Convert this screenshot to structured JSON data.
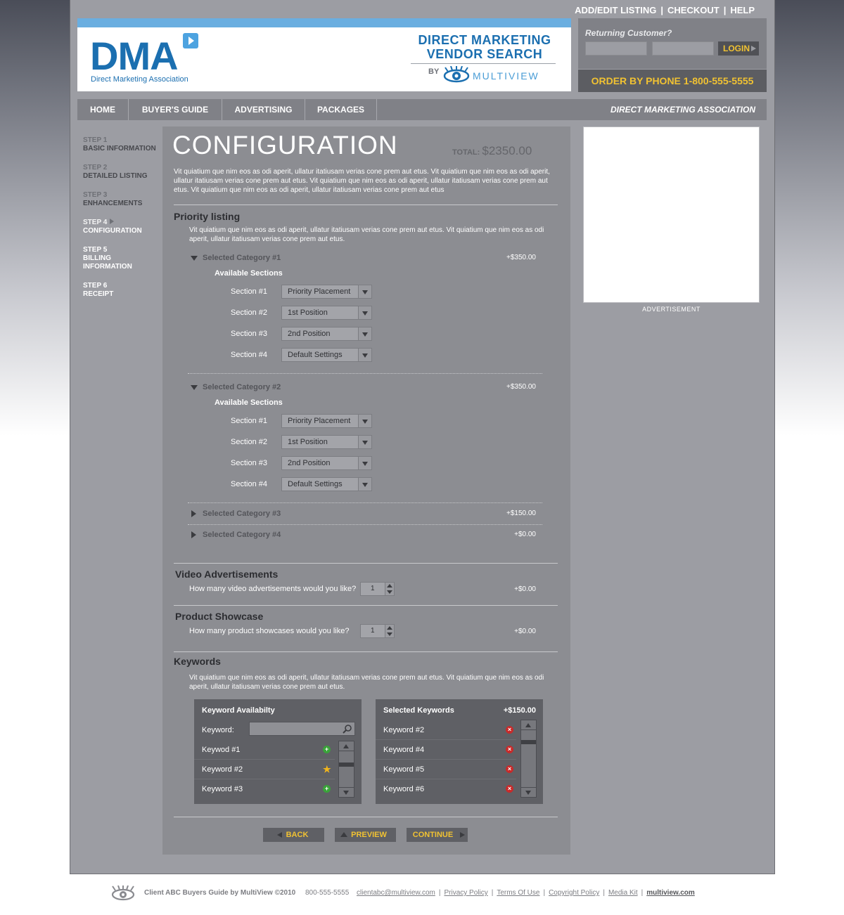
{
  "top_links": [
    "ADD/EDIT LISTING",
    "CHECKOUT",
    "HELP"
  ],
  "header": {
    "logo_text": "DMA",
    "logo_subtitle": "Direct Marketing Association",
    "vendor_title_1": "DIRECT MARKETING",
    "vendor_title_2": "VENDOR SEARCH",
    "by_label": "BY",
    "multiview_text": "MULTIVIEW"
  },
  "login": {
    "title": "Returning Customer?",
    "button_label": "LOGIN",
    "username_value": "",
    "password_value": ""
  },
  "phone_banner": "ORDER BY PHONE 1-800-555-5555",
  "nav": {
    "items": [
      "HOME",
      "BUYER'S GUIDE",
      "ADVERTISING",
      "PACKAGES"
    ],
    "right_label": "DIRECT MARKETING ASSOCIATION"
  },
  "steps": [
    {
      "num": "STEP 1",
      "label": "BASIC INFORMATION"
    },
    {
      "num": "STEP 2",
      "label": "DETAILED LISTING"
    },
    {
      "num": "STEP 3",
      "label": "ENHANCEMENTS"
    },
    {
      "num": "STEP 4",
      "label": "CONFIGURATION"
    },
    {
      "num": "STEP 5",
      "label": "BILLING INFORMATION"
    },
    {
      "num": "STEP 6",
      "label": "RECEIPT"
    }
  ],
  "main": {
    "title": "CONFIGURATION",
    "total_label": "TOTAL:",
    "total_value": "$2350.00",
    "intro": "Vit quiatium que nim eos as odi aperit, ullatur itatiusam verias cone prem aut etus. Vit quiatium que nim eos as odi aperit, ullatur itatiusam verias cone prem aut etus. Vit quiatium que nim eos as odi aperit, ullatur itatiusam verias cone prem aut etus. Vit quiatium que nim eos as odi aperit, ullatur itatiusam verias cone prem aut etus"
  },
  "priority": {
    "title": "Priority listing",
    "desc": "Vit quiatium que nim eos as odi aperit, ullatur itatiusam verias cone prem aut etus. Vit quiatium que nim eos as odi aperit, ullatur itatiusam verias cone prem aut etus.",
    "available_label": "Available Sections",
    "categories": [
      {
        "label": "Selected Category #1",
        "price": "+$350.00",
        "expanded": true,
        "sections": [
          {
            "label": "Section #1",
            "value": "Priority Placement"
          },
          {
            "label": "Section #2",
            "value": "1st Position"
          },
          {
            "label": "Section #3",
            "value": "2nd Position"
          },
          {
            "label": "Section #4",
            "value": "Default Settings"
          }
        ]
      },
      {
        "label": "Selected Category #2",
        "price": "+$350.00",
        "expanded": true,
        "sections": [
          {
            "label": "Section #1",
            "value": "Priority Placement"
          },
          {
            "label": "Section #2",
            "value": "1st Position"
          },
          {
            "label": "Section #3",
            "value": "2nd Position"
          },
          {
            "label": "Section #4",
            "value": "Default Settings"
          }
        ]
      },
      {
        "label": "Selected Category #3",
        "price": "+$150.00",
        "expanded": false
      },
      {
        "label": "Selected Category #4",
        "price": "+$0.00",
        "expanded": false
      }
    ]
  },
  "video": {
    "title": "Video Advertisements",
    "question": "How many video advertisements would you like?",
    "value": "1",
    "price": "+$0.00"
  },
  "showcase": {
    "title": "Product Showcase",
    "question": "How many product showcases would you like?",
    "value": "1",
    "price": "+$0.00"
  },
  "keywords": {
    "title": "Keywords",
    "desc": "Vit quiatium que nim eos as odi aperit, ullatur itatiusam verias cone prem aut etus. Vit quiatium que nim eos as odi aperit, ullatur itatiusam verias cone prem aut etus.",
    "availability": {
      "title": "Keyword Availabilty",
      "search_label": "Keyword:",
      "search_value": "",
      "items": [
        {
          "label": "Keywod #1",
          "icon": "add-icon"
        },
        {
          "label": "Keyword #2",
          "icon": "star-icon"
        },
        {
          "label": "Keyword #3",
          "icon": "add-icon"
        }
      ]
    },
    "selected": {
      "title": "Selected Keywords",
      "price": "+$150.00",
      "items": [
        {
          "label": "Keyword #2",
          "icon": "remove-icon"
        },
        {
          "label": "Keyword #4",
          "icon": "remove-icon"
        },
        {
          "label": "Keyword #5",
          "icon": "remove-icon"
        },
        {
          "label": "Keyword #6",
          "icon": "remove-icon"
        }
      ]
    }
  },
  "actions": {
    "back": "BACK",
    "preview": "PREVIEW",
    "continue": "CONTINUE"
  },
  "advertisement_label": "ADVERTISEMENT",
  "footer": {
    "brand": "Client ABC Buyers Guide by MultiView ©2010",
    "phone": "800-555-5555",
    "links": [
      "clientabc@multiview.com",
      "Privacy Policy",
      "Terms Of Use",
      "Copyright Policy",
      "Media Kit",
      "multiview.com"
    ]
  },
  "colors": {
    "accent_yellow": "#f1c232",
    "brand_blue": "#1b6fb0",
    "panel_gray": "#8c8d92"
  }
}
